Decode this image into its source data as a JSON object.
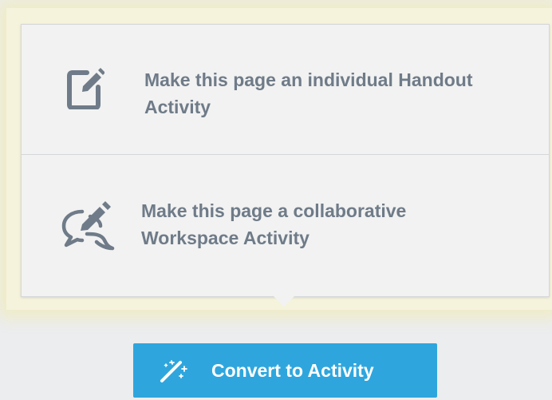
{
  "menu": {
    "options": [
      {
        "icon": "edit-icon",
        "label": "Make this page an individual Handout Activity"
      },
      {
        "icon": "chat-edit-icon",
        "label": "Make this page a collaborative Workspace Activity"
      }
    ]
  },
  "convert_button": {
    "icon": "magic-wand-icon",
    "label": "Convert to Activity"
  },
  "colors": {
    "accent": "#2ea6dd",
    "option_text": "#6f7b88",
    "popover_bg": "#f2f2f2",
    "highlight": "#f5f3dc"
  }
}
